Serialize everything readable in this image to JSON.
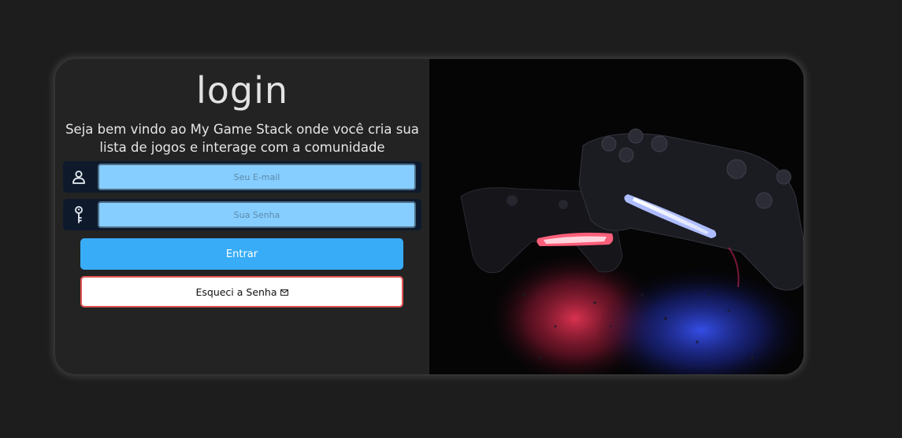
{
  "login": {
    "title": "login",
    "welcome_text": "Seja bem vindo ao My Game Stack onde você cria sua lista de jogos e interage com a comunidade",
    "email_placeholder": "Seu E-mail",
    "password_placeholder": "Sua Senha",
    "enter_label": "Entrar",
    "forgot_label": "Esqueci a Senha",
    "icons": {
      "email": "user-icon",
      "password": "key-icon",
      "forgot": "envelope-icon"
    }
  },
  "hero_image": {
    "subject": "gamepad-controllers-photo"
  },
  "colors": {
    "page_bg": "#1d1d1d",
    "card_bg": "#232323",
    "input_bg": "#86ceff",
    "enter_button": "#38acf7",
    "forgot_border": "#e45454"
  }
}
